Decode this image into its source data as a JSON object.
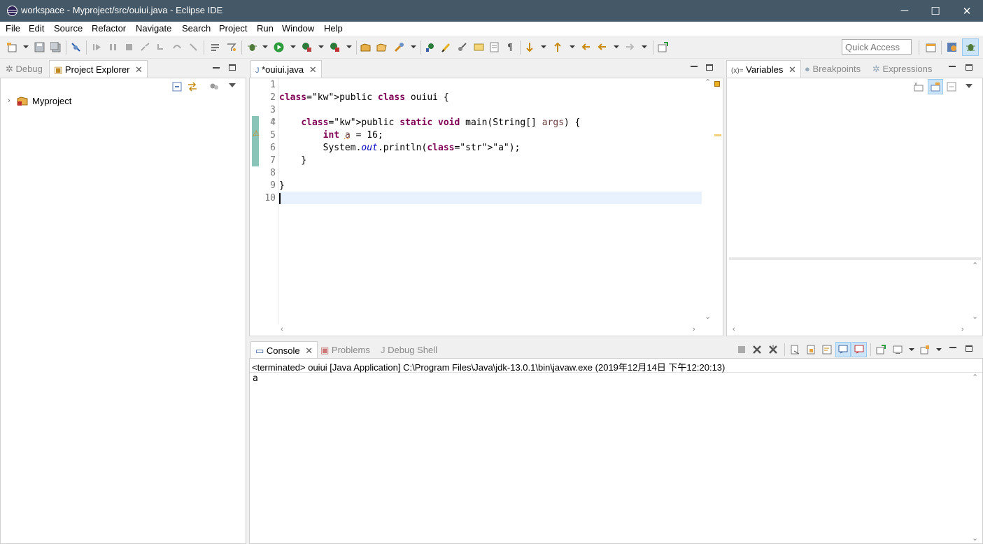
{
  "window": {
    "title": "workspace - Myproject/src/ouiui.java - Eclipse IDE",
    "minimize": "─",
    "maximize": "☐",
    "close": "✕"
  },
  "menu": [
    "File",
    "Edit",
    "Source",
    "Refactor",
    "Navigate",
    "Search",
    "Project",
    "Run",
    "Window",
    "Help"
  ],
  "quick_access": {
    "placeholder": "Quick Access"
  },
  "left_panel": {
    "tabs": [
      {
        "label": "Debug"
      },
      {
        "label": "Project Explorer"
      }
    ],
    "tree": [
      {
        "label": "Myproject"
      }
    ]
  },
  "editor": {
    "tab_label": "*ouiui.java",
    "lines": [
      {
        "n": "1",
        "code": ""
      },
      {
        "n": "2",
        "code": "public class ouiui {"
      },
      {
        "n": "3",
        "code": ""
      },
      {
        "n": "4",
        "code": "    public static void main(String[] args) {"
      },
      {
        "n": "5",
        "code": "        int a = 16;"
      },
      {
        "n": "6",
        "code": "        System.out.println(\"a\");"
      },
      {
        "n": "7",
        "code": "    }"
      },
      {
        "n": "8",
        "code": ""
      },
      {
        "n": "9",
        "code": "}"
      },
      {
        "n": "10",
        "code": ""
      }
    ]
  },
  "right_panel": {
    "tabs": [
      {
        "label": "Variables"
      },
      {
        "label": "Breakpoints"
      },
      {
        "label": "Expressions"
      }
    ],
    "variables_prefix": "(x)="
  },
  "bottom_panel": {
    "tabs": [
      {
        "label": "Console"
      },
      {
        "label": "Problems"
      },
      {
        "label": "Debug Shell"
      }
    ],
    "status": "<terminated> ouiui [Java Application] C:\\Program Files\\Java\\jdk-13.0.1\\bin\\javaw.exe (2019年12月14日 下午12:20:13)",
    "output": "a"
  },
  "colors": {
    "titlebar": "#445867",
    "keyword": "#7f0055",
    "string": "#2a00ff",
    "field": "#0000c0",
    "current_line": "#e8f2fe",
    "tab_active_bg": "#ffffff"
  }
}
